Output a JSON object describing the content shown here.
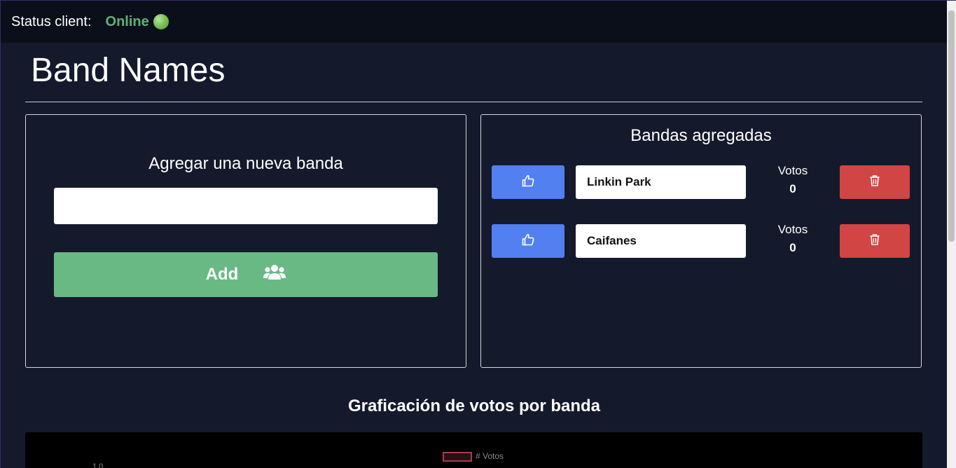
{
  "header": {
    "status_label": "Status client:",
    "status_value": "Online",
    "status_icon": "green-circle-icon"
  },
  "page": {
    "title": "Band Names"
  },
  "add_panel": {
    "title": "Agregar una nueva banda",
    "input_value": "",
    "input_placeholder": "",
    "add_label": "Add",
    "add_icon": "users-icon"
  },
  "list_panel": {
    "title": "Bandas agregadas",
    "votes_label": "Votos",
    "bands": [
      {
        "name": "Linkin Park",
        "votes": "0"
      },
      {
        "name": "Caifanes",
        "votes": "0"
      }
    ],
    "vote_icon": "thumbs-up-icon",
    "delete_icon": "trash-icon"
  },
  "chart": {
    "title": "Graficación de votos por banda",
    "legend_label": "# Votos",
    "tick_top": "1.0"
  },
  "colors": {
    "online": "#5fb179",
    "vote_button": "#5380f0",
    "delete_button": "#d14545",
    "add_button": "#69b985",
    "background": "#141a2b"
  }
}
